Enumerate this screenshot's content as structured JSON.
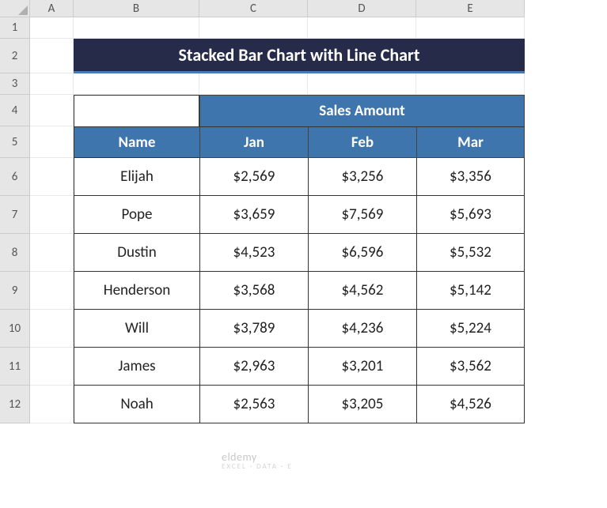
{
  "columns": [
    "A",
    "B",
    "C",
    "D",
    "E"
  ],
  "rows": [
    "1",
    "2",
    "3",
    "4",
    "5",
    "6",
    "7",
    "8",
    "9",
    "10",
    "11",
    "12"
  ],
  "title": "Stacked Bar Chart with Line Chart",
  "merge_header": "Sales Amount",
  "headers": {
    "name": "Name",
    "jan": "Jan",
    "feb": "Feb",
    "mar": "Mar"
  },
  "data": [
    {
      "name": "Elijah",
      "jan": "$2,569",
      "feb": "$3,256",
      "mar": "$3,356"
    },
    {
      "name": "Pope",
      "jan": "$3,659",
      "feb": "$7,569",
      "mar": "$5,693"
    },
    {
      "name": "Dustin",
      "jan": "$4,523",
      "feb": "$6,596",
      "mar": "$5,532"
    },
    {
      "name": "Henderson",
      "jan": "$3,568",
      "feb": "$4,562",
      "mar": "$5,142"
    },
    {
      "name": "Will",
      "jan": "$3,789",
      "feb": "$4,236",
      "mar": "$5,224"
    },
    {
      "name": "James",
      "jan": "$2,963",
      "feb": "$3,201",
      "mar": "$3,562"
    },
    {
      "name": "Noah",
      "jan": "$2,563",
      "feb": "$3,205",
      "mar": "$4,526"
    }
  ],
  "watermark": {
    "brand": "eldemy",
    "tagline": "EXCEL · DATA · E"
  },
  "chart_data": {
    "type": "table",
    "title": "Stacked Bar Chart with Line Chart — Sales Amount",
    "categories": [
      "Elijah",
      "Pope",
      "Dustin",
      "Henderson",
      "Will",
      "James",
      "Noah"
    ],
    "series": [
      {
        "name": "Jan",
        "values": [
          2569,
          3659,
          4523,
          3568,
          3789,
          2963,
          2563
        ]
      },
      {
        "name": "Feb",
        "values": [
          3256,
          7569,
          6596,
          4562,
          4236,
          3201,
          3205
        ]
      },
      {
        "name": "Mar",
        "values": [
          3356,
          5693,
          5532,
          5142,
          5224,
          3562,
          4526
        ]
      }
    ],
    "xlabel": "Name",
    "ylabel": "Sales Amount ($)"
  }
}
